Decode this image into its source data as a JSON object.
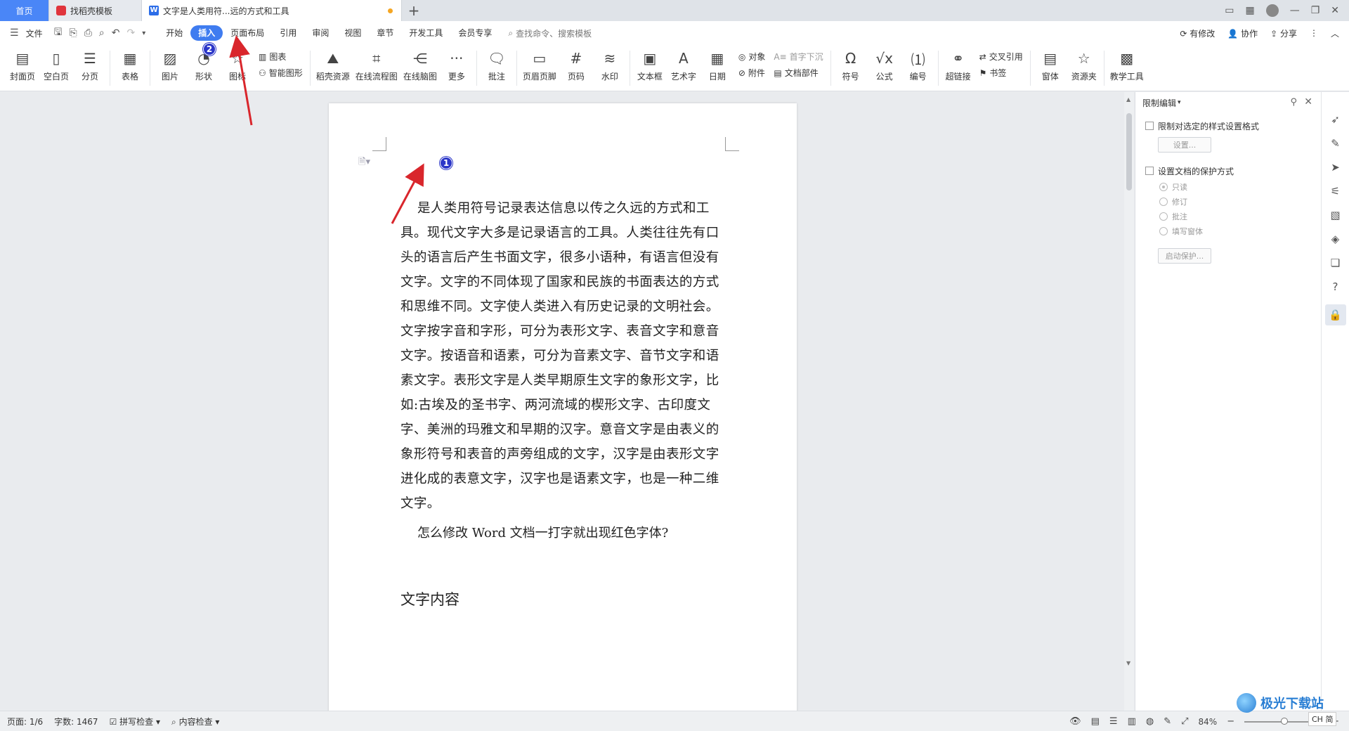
{
  "tabs": [
    {
      "label": "首页"
    },
    {
      "label": "找稻壳模板"
    },
    {
      "label": "文字是人类用符...远的方式和工具"
    }
  ],
  "menu": {
    "file": "文件",
    "items": [
      "开始",
      "插入",
      "页面布局",
      "引用",
      "审阅",
      "视图",
      "章节",
      "开发工具",
      "会员专享"
    ],
    "active": "插入",
    "search_placeholder": "查找命令、搜索模板",
    "right": {
      "modified": "有修改",
      "collab": "协作",
      "share": "分享"
    }
  },
  "ribbon": {
    "cover": "封面页",
    "blank": "空白页",
    "pagebreak": "分页",
    "table": "表格",
    "picture": "图片",
    "shape": "形状",
    "icon": "图标",
    "chart": "图表",
    "smartart": "智能图形",
    "daoke": "稻壳资源",
    "flowchart": "在线流程图",
    "mindmap": "在线脑图",
    "more": "更多",
    "comment": "批注",
    "header_footer": "页眉页脚",
    "page_number": "页码",
    "watermark": "水印",
    "textbox": "文本框",
    "wordart": "艺术字",
    "date": "日期",
    "object": "对象",
    "attachment": "附件",
    "dropcap": "首字下沉",
    "docparts": "文档部件",
    "symbol": "符号",
    "formula": "公式",
    "numbering": "编号",
    "hyperlink": "超链接",
    "crossref": "交叉引用",
    "bookmark": "书签",
    "form": "窗体",
    "resources": "资源夹",
    "teaching": "教学工具"
  },
  "document": {
    "paragraph": "是人类用符号记录表达信息以传之久远的方式和工具。现代文字大多是记录语言的工具。人类往往先有口头的语言后产生书面文字，很多小语种，有语言但没有文字。文字的不同体现了国家和民族的书面表达的方式和思维不同。文字使人类进入有历史记录的文明社会。文字按字音和字形，可分为表形文字、表音文字和意音文字。按语音和语素，可分为音素文字、音节文字和语素文字。表形文字是人类早期原生文字的象形文字，比如:古埃及的圣书字、两河流域的楔形文字、古印度文字、美洲的玛雅文和早期的汉字。意音文字是由表义的象形符号和表音的声旁组成的文字，汉字是由表形文字进化成的表意文字，汉字也是语素文字，也是一种二维文字。",
    "question": "怎么修改 Word 文档一打字就出现红色字体?",
    "heading": "文字内容",
    "badge1": "1",
    "badge2": "2"
  },
  "panel": {
    "title": "限制编辑",
    "restrict_format": "限制对选定的样式设置格式",
    "settings_btn": "设置...",
    "protect": "设置文档的保护方式",
    "options": [
      "只读",
      "修订",
      "批注",
      "填写窗体"
    ],
    "start_btn": "启动保护..."
  },
  "status": {
    "page": "页面: 1/6",
    "words": "字数: 1467",
    "spell": "拼写检查",
    "content": "内容检查",
    "zoom": "84%"
  },
  "watermark": {
    "brand": "极光下载站",
    "cn": "CH 简"
  },
  "colors": {
    "accent": "#3f7cf0",
    "arrow": "#d9262c",
    "badge": "#2b36c8",
    "home_tab": "#4a86f7"
  }
}
